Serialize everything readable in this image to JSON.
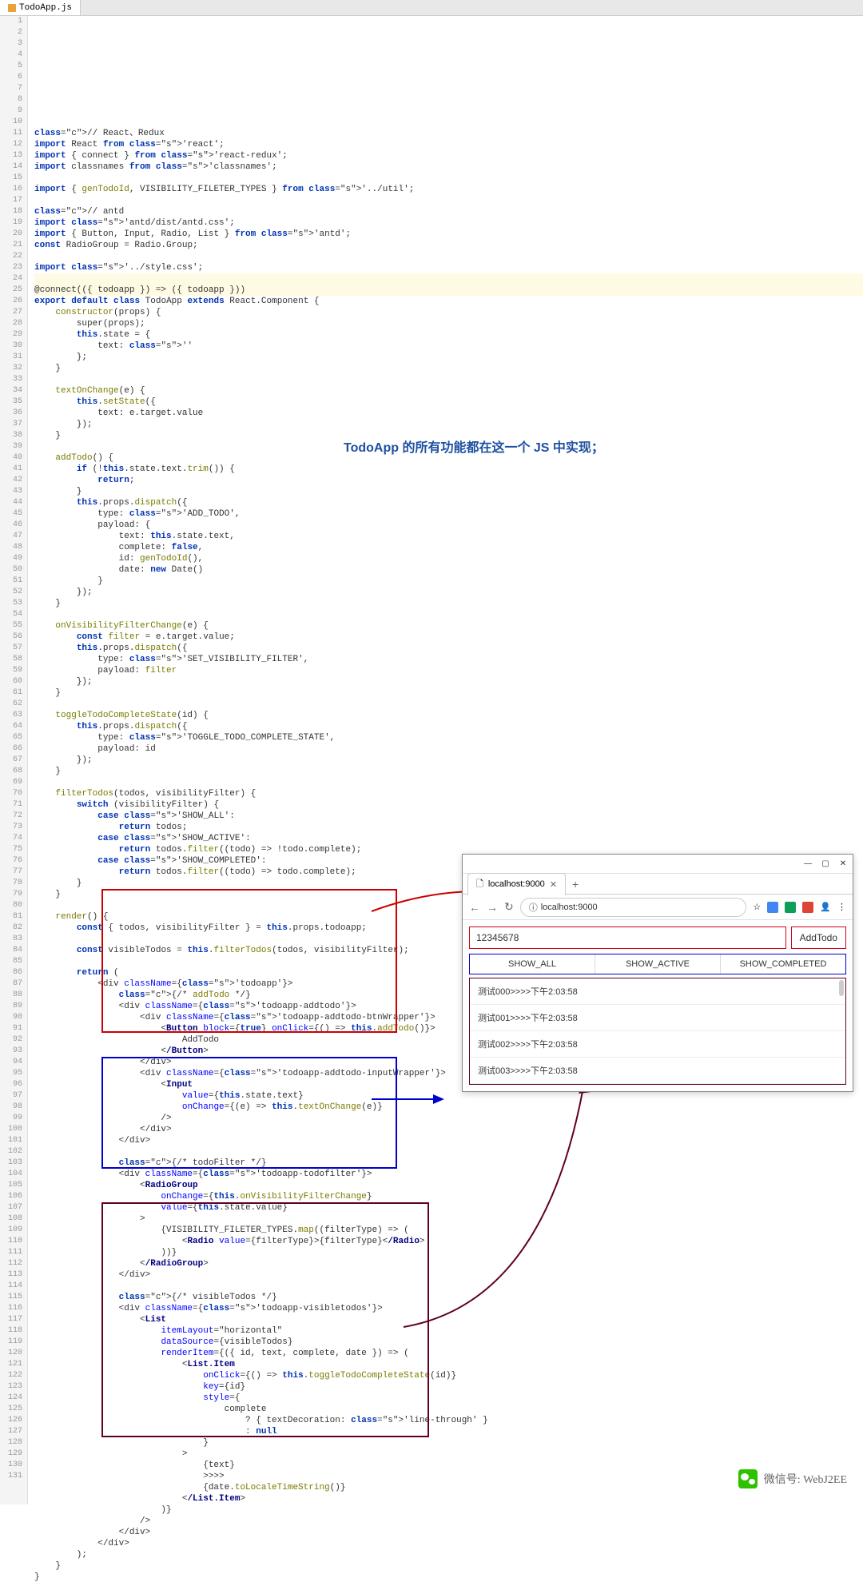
{
  "tab": {
    "filename": "TodoApp.js"
  },
  "annotation": "TodoApp 的所有功能都在这一个 JS 中实现；",
  "code_lines": [
    "// React、Redux",
    "import React from 'react';",
    "import { connect } from 'react-redux';",
    "import classnames from 'classnames';",
    "",
    "import { genTodoId, VISIBILITY_FILETER_TYPES } from '../util';",
    "",
    "// antd",
    "import 'antd/dist/antd.css';",
    "import { Button, Input, Radio, List } from 'antd';",
    "const RadioGroup = Radio.Group;",
    "",
    "import '../style.css';",
    "",
    "@connect(({ todoapp }) => ({ todoapp }))",
    "export default class TodoApp extends React.Component {",
    "    constructor(props) {",
    "        super(props);",
    "        this.state = {",
    "            text: ''",
    "        };",
    "    }",
    "",
    "    textOnChange(e) {",
    "        this.setState({",
    "            text: e.target.value",
    "        });",
    "    }",
    "",
    "    addTodo() {",
    "        if (!this.state.text.trim()) {",
    "            return;",
    "        }",
    "        this.props.dispatch({",
    "            type: 'ADD_TODO',",
    "            payload: {",
    "                text: this.state.text,",
    "                complete: false,",
    "                id: genTodoId(),",
    "                date: new Date()",
    "            }",
    "        });",
    "    }",
    "",
    "    onVisibilityFilterChange(e) {",
    "        const filter = e.target.value;",
    "        this.props.dispatch({",
    "            type: 'SET_VISIBILITY_FILTER',",
    "            payload: filter",
    "        });",
    "    }",
    "",
    "    toggleTodoCompleteState(id) {",
    "        this.props.dispatch({",
    "            type: 'TOGGLE_TODO_COMPLETE_STATE',",
    "            payload: id",
    "        });",
    "    }",
    "",
    "    filterTodos(todos, visibilityFilter) {",
    "        switch (visibilityFilter) {",
    "            case 'SHOW_ALL':",
    "                return todos;",
    "            case 'SHOW_ACTIVE':",
    "                return todos.filter((todo) => !todo.complete);",
    "            case 'SHOW_COMPLETED':",
    "                return todos.filter((todo) => todo.complete);",
    "        }",
    "    }",
    "",
    "    render() {",
    "        const { todos, visibilityFilter } = this.props.todoapp;",
    "",
    "        const visibleTodos = this.filterTodos(todos, visibilityFilter);",
    "",
    "        return (",
    "            <div className={'todoapp'}>",
    "                {/* addTodo */}",
    "                <div className={'todoapp-addtodo'}>",
    "                    <div className={'todoapp-addtodo-btnWrapper'}>",
    "                        <Button block={true} onClick={() => this.addTodo()}>",
    "                            AddTodo",
    "                        </Button>",
    "                    </div>",
    "                    <div className={'todoapp-addtodo-inputWrapper'}>",
    "                        <Input",
    "                            value={this.state.text}",
    "                            onChange={(e) => this.textOnChange(e)}",
    "                        />",
    "                    </div>",
    "                </div>",
    "",
    "                {/* todoFilter */}",
    "                <div className={'todoapp-todofilter'}>",
    "                    <RadioGroup",
    "                        onChange={this.onVisibilityFilterChange}",
    "                        value={this.state.value}",
    "                    >",
    "                        {VISIBILITY_FILETER_TYPES.map((filterType) => (",
    "                            <Radio value={filterType}>{filterType}</Radio>",
    "                        ))}",
    "                    </RadioGroup>",
    "                </div>",
    "",
    "                {/* visibleTodos */}",
    "                <div className={'todoapp-visibletodos'}>",
    "                    <List",
    "                        itemLayout=\"horizontal\"",
    "                        dataSource={visibleTodos}",
    "                        renderItem={({ id, text, complete, date }) => (",
    "                            <List.Item",
    "                                onClick={() => this.toggleTodoCompleteState(id)}",
    "                                key={id}",
    "                                style={",
    "                                    complete",
    "                                        ? { textDecoration: 'line-through' }",
    "                                        : null",
    "                                }",
    "                            >",
    "                                {text}",
    "                                >>>>",
    "                                {date.toLocaleTimeString()}",
    "                            </List.Item>",
    "                        )}",
    "                    />",
    "                </div>",
    "            </div>",
    "        );",
    "    }",
    "}",
    ""
  ],
  "browser": {
    "tab_title": "localhost:9000",
    "url": "localhost:9000",
    "input_value": "12345678",
    "add_button": "AddTodo",
    "filters": [
      "SHOW_ALL",
      "SHOW_ACTIVE",
      "SHOW_COMPLETED"
    ],
    "todos": [
      "测试000>>>>下午2:03:58",
      "测试001>>>>下午2:03:58",
      "测试002>>>>下午2:03:58",
      "测试003>>>>下午2:03:58"
    ]
  },
  "wechat": {
    "label": "微信号: WebJ2EE"
  }
}
